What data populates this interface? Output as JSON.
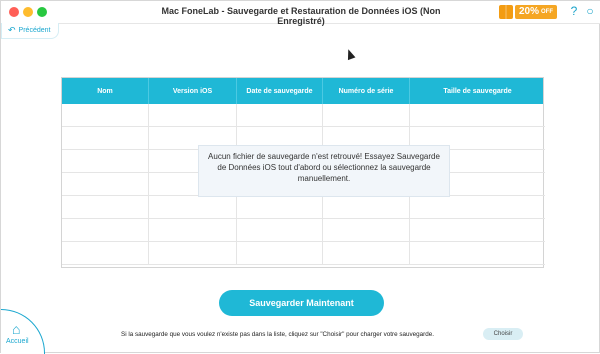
{
  "window": {
    "title": "Mac FoneLab - Sauvegarde et Restauration de Données iOS (Non Enregistré)"
  },
  "promo": {
    "discount": "20%",
    "off_label": "OFF"
  },
  "nav": {
    "back_label": "Précédent",
    "home_label": "Accueil"
  },
  "table": {
    "headers": [
      "Nom",
      "Version iOS",
      "Date de sauvegarde",
      "Numéro de série",
      "Taille de sauvegarde"
    ],
    "rows": 7
  },
  "notice": {
    "message": "Aucun fichier de sauvegarde n'est retrouvé! Essayez Sauvegarde de Données iOS tout d'abord ou sélectionnez la sauvegarde manuellement."
  },
  "actions": {
    "save_now": "Sauvegarder Maintenant",
    "choose": "Choisir"
  },
  "footer": {
    "hint": "Si la sauvegarde que vous voulez n'existe pas dans la liste, cliquez sur \"Choisir\" pour charger votre sauvegarde."
  },
  "colors": {
    "accent": "#1fb8d6",
    "promo": "#f5a623"
  },
  "icons": {
    "back": "back-arrow-icon",
    "help": "help-icon",
    "chat": "chat-icon",
    "home": "home-icon",
    "gift": "gift-icon"
  }
}
